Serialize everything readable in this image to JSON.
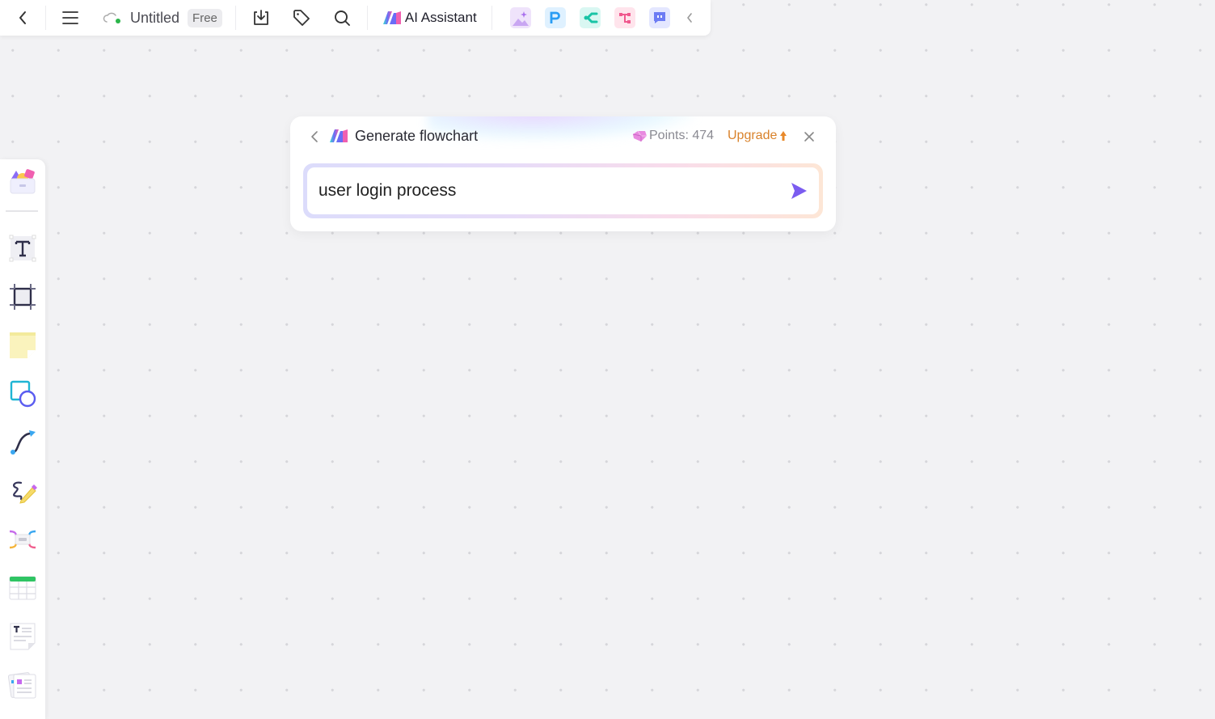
{
  "topbar": {
    "doc_title": "Untitled",
    "plan_badge": "Free",
    "ai_assistant_label": "AI Assistant",
    "app_icons": [
      {
        "name": "ai-image-icon",
        "bg": "#efe3fb"
      },
      {
        "name": "ai-presentation-icon",
        "bg": "#dff1ff"
      },
      {
        "name": "ai-mindmap-icon",
        "bg": "#d9f7f2"
      },
      {
        "name": "ai-flowchart-icon",
        "bg": "#ffe4ec"
      },
      {
        "name": "ai-chat-icon",
        "bg": "#e4e7ff"
      }
    ]
  },
  "leftbar": {
    "tools": [
      "templates",
      "text",
      "frame",
      "sticky-note",
      "shapes",
      "connector",
      "pen",
      "mindmap",
      "table",
      "text-document",
      "cards"
    ]
  },
  "dialog": {
    "title": "Generate flowchart",
    "points_label": "Points: 474",
    "upgrade_label": "Upgrade",
    "input_value": "user login process",
    "accent_color": "#7b5cf0",
    "upgrade_color": "#d9822b"
  }
}
